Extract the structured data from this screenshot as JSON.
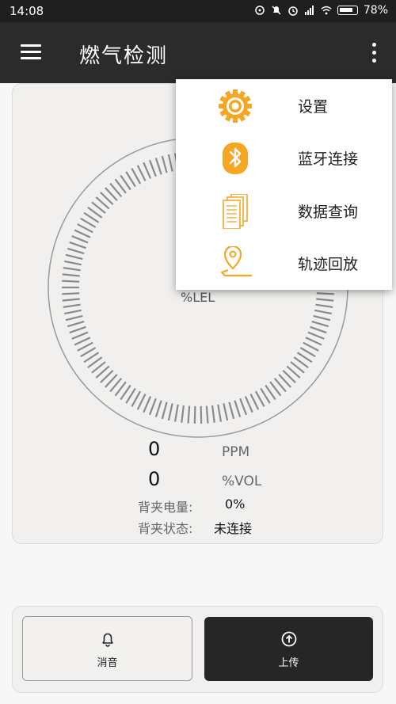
{
  "status_bar": {
    "time": "14:08",
    "battery": "78%"
  },
  "app_bar": {
    "title": "燃气检测"
  },
  "gauge": {
    "unit": "%LEL"
  },
  "readings": [
    {
      "value": "0",
      "unit": "PPM"
    },
    {
      "value": "0",
      "unit": "%VOL"
    }
  ],
  "backpack": {
    "battery_label": "背夹电量:",
    "battery_value": "0%",
    "status_label": "背夹状态:",
    "status_value": "未连接"
  },
  "buttons": {
    "mute": "消音",
    "upload": "上传"
  },
  "menu": {
    "items": [
      {
        "label": "设置",
        "icon": "gear-icon"
      },
      {
        "label": "蓝牙连接",
        "icon": "bluetooth-icon"
      },
      {
        "label": "数据查询",
        "icon": "documents-icon"
      },
      {
        "label": "轨迹回放",
        "icon": "location-track-icon"
      }
    ]
  },
  "colors": {
    "accent": "#f5a623",
    "appbar": "#2b2b2b"
  }
}
